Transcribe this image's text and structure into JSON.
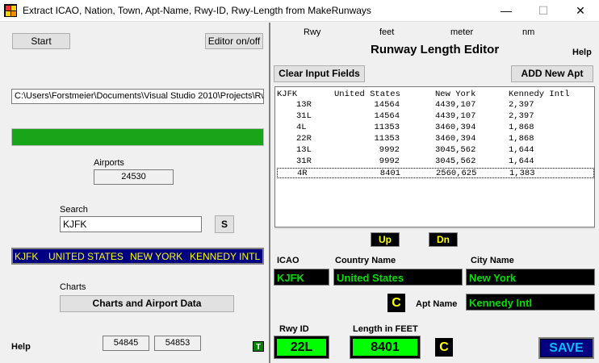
{
  "window": {
    "title": "Extract ICAO, Nation, Town, Apt-Name, Rwy-ID, Rwy-Length from MakeRunways",
    "min_glyph": "—",
    "max_glyph": "☐",
    "close_glyph": "✕"
  },
  "left": {
    "start_label": "Start",
    "editor_label": "Editor on/off",
    "path_value": "C:\\Users\\Forstmeier\\Documents\\Visual Studio 2010\\Projects\\Rw",
    "progress_color": "#19a519",
    "progress_fraction": 1.0,
    "airports_label": "Airports",
    "airports_value": "24530",
    "search_label": "Search",
    "search_value": "KJFK",
    "search_button": "S",
    "result": {
      "icao": "KJFK",
      "country": "UNITED STATES",
      "city": "NEW YORK",
      "name": "KENNEDY INTL"
    },
    "charts_label": "Charts",
    "charts_button": "Charts and Airport Data",
    "help_label": "Help",
    "num1": "54845",
    "num2": "54853",
    "t_button": "T"
  },
  "right": {
    "col_rwy": "Rwy",
    "col_feet": "feet",
    "col_meter": "meter",
    "col_nm": "nm",
    "title": "Runway Length Editor",
    "help_label": "Help",
    "clear_button": "Clear Input Fields",
    "add_button": "ADD New Apt",
    "list_header": {
      "a": "KJFK",
      "b": "United States",
      "c": "New York",
      "d": "Kennedy Intl"
    },
    "runways": [
      {
        "rwy": "13R",
        "feet": "14564",
        "meter": "4439,107",
        "nm": "2,397"
      },
      {
        "rwy": "31L",
        "feet": "14564",
        "meter": "4439,107",
        "nm": "2,397"
      },
      {
        "rwy": "4L",
        "feet": "11353",
        "meter": "3460,394",
        "nm": "1,868"
      },
      {
        "rwy": "22R",
        "feet": "11353",
        "meter": "3460,394",
        "nm": "1,868"
      },
      {
        "rwy": "13L",
        "feet": "9992",
        "meter": "3045,562",
        "nm": "1,644"
      },
      {
        "rwy": "31R",
        "feet": "9992",
        "meter": "3045,562",
        "nm": "1,644"
      },
      {
        "rwy": "4R",
        "feet": "8401",
        "meter": "2560,625",
        "nm": "1,383"
      }
    ],
    "up_button": "Up",
    "dn_button": "Dn",
    "icao_label": "ICAO",
    "country_label": "Country Name",
    "city_label": "City Name",
    "icao_value": "KJFK",
    "country_value": "United States",
    "city_value": "New York",
    "c_button": "C",
    "apt_name_label": "Apt Name",
    "apt_name_value": "Kennedy Intl",
    "rwy_id_label": "Rwy ID",
    "length_label": "Length in FEET",
    "rwy_id_value": "22L",
    "length_value": "8401",
    "save_button": "SAVE"
  },
  "colors": {
    "accent_green": "#00e000",
    "yellow": "#ffff00",
    "navy": "#000080",
    "save_blue": "#0000ff"
  }
}
